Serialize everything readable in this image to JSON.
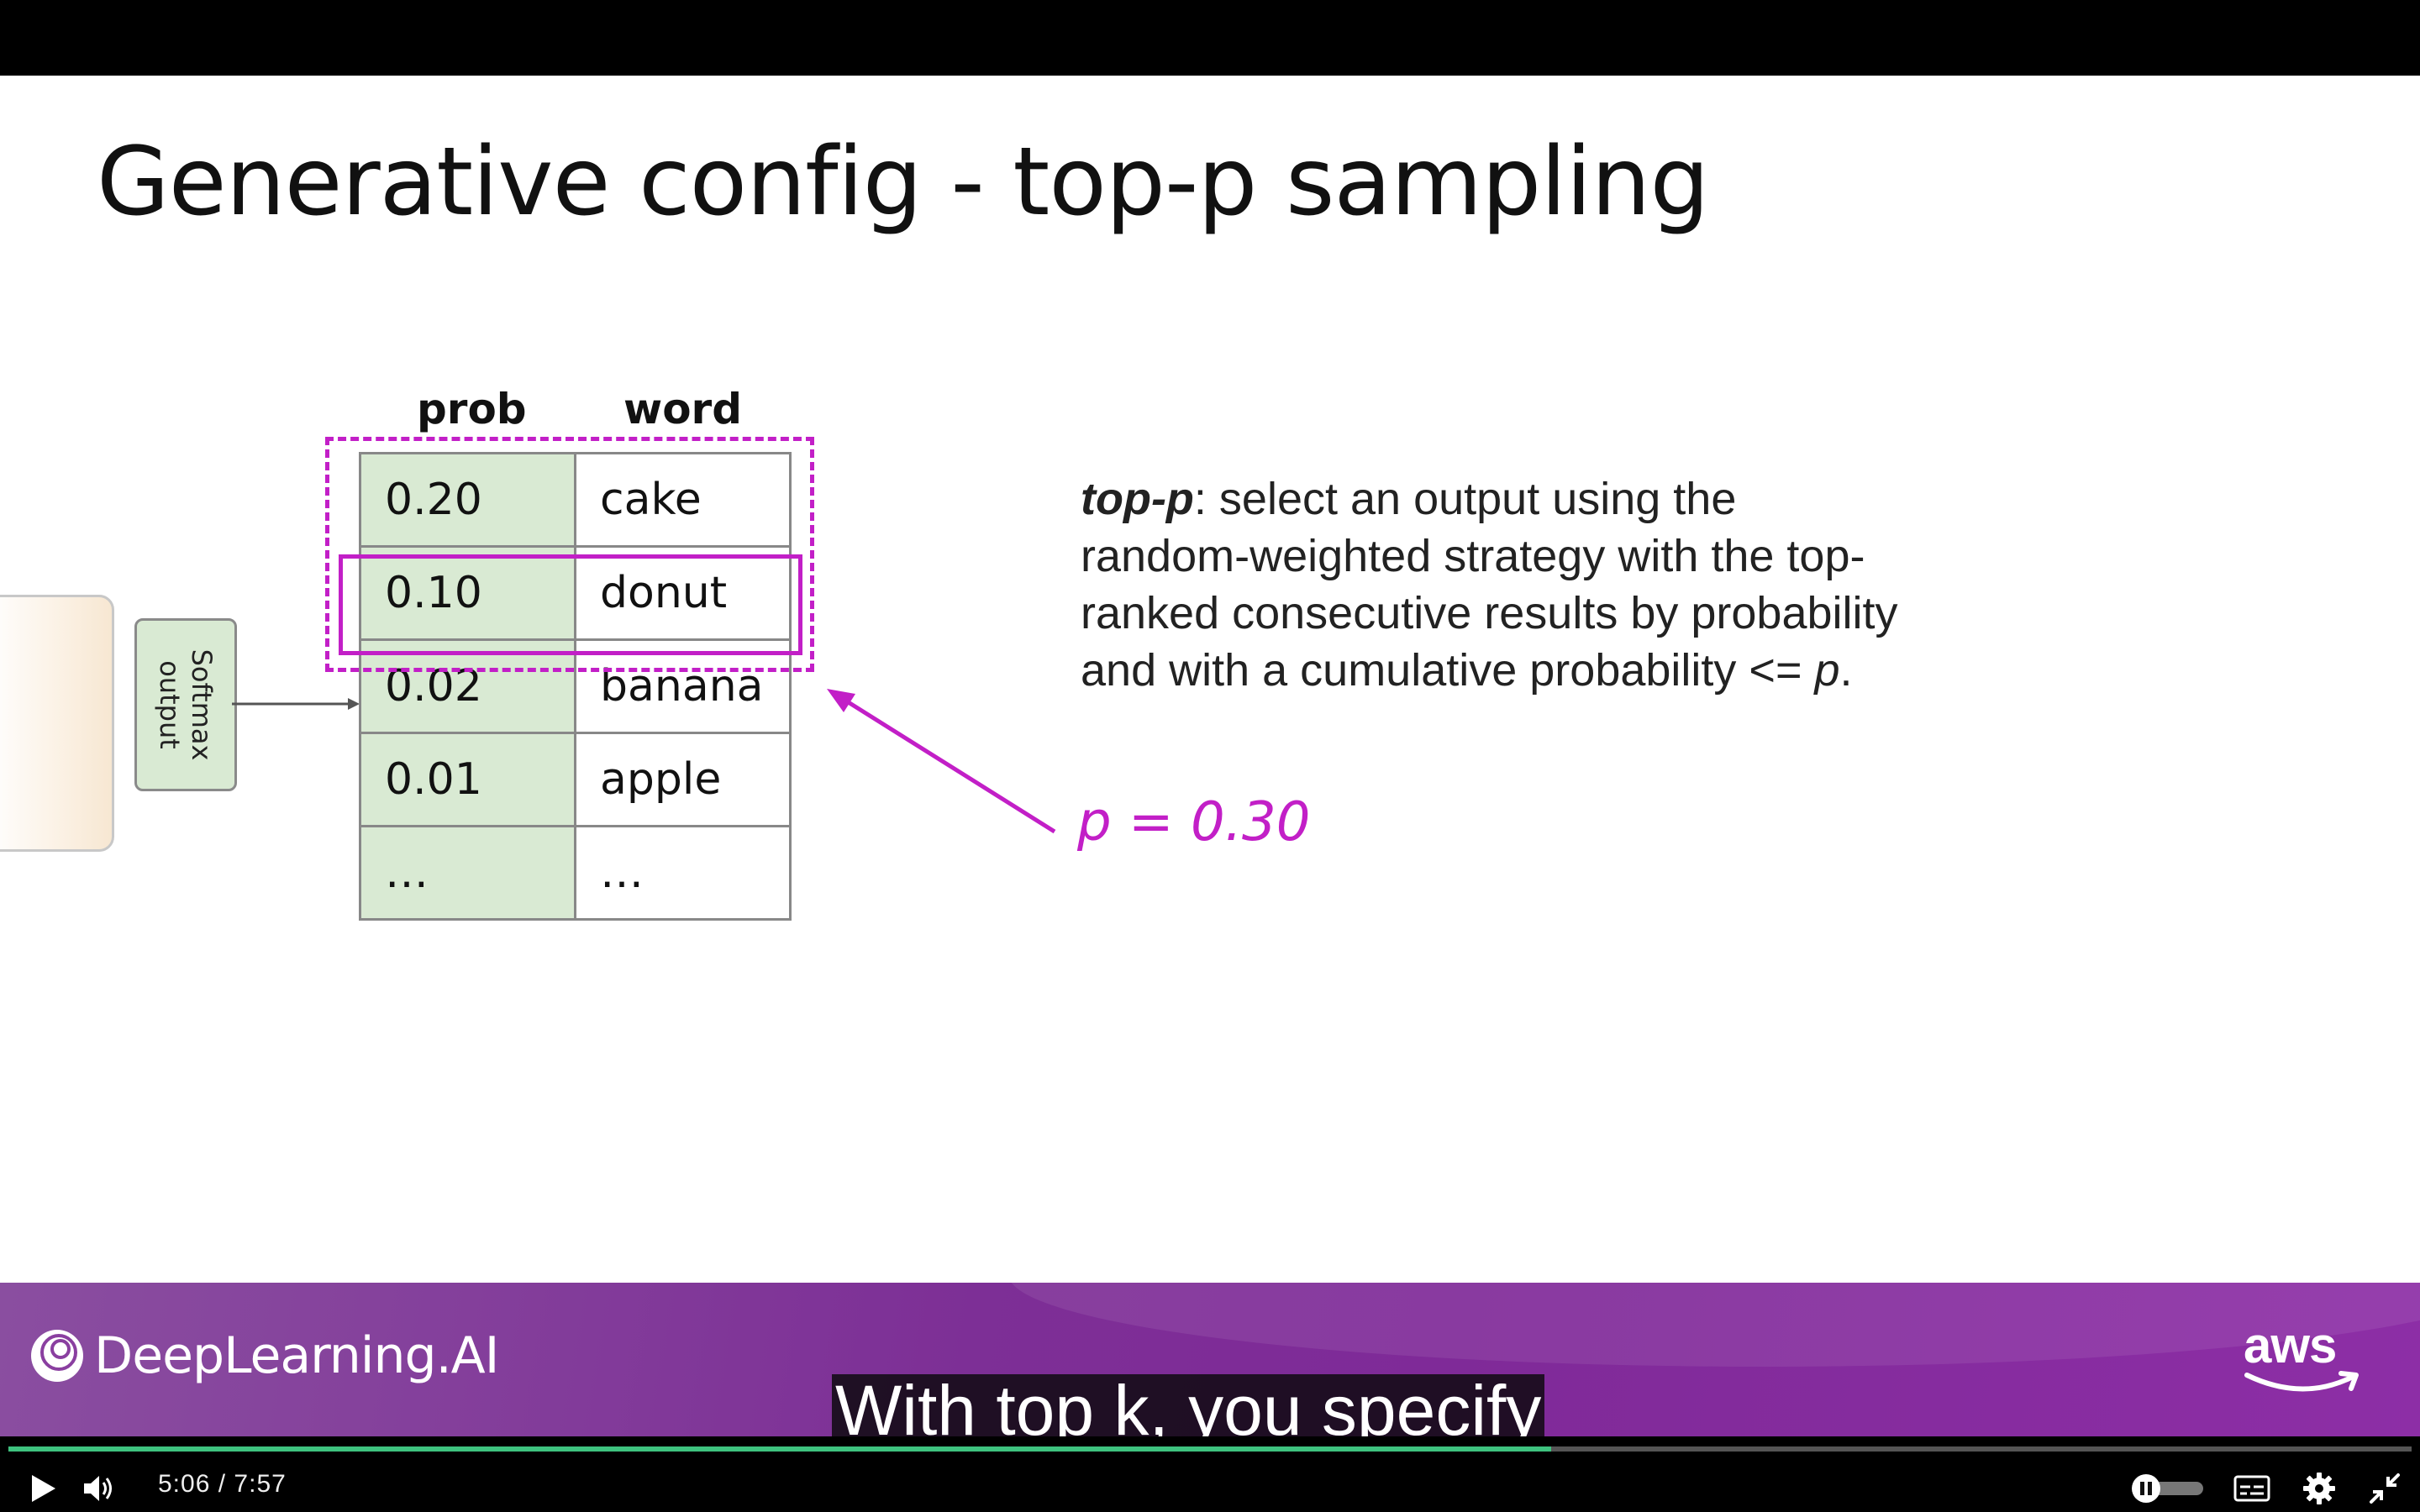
{
  "slide": {
    "title": "Generative config - top-p sampling",
    "softmax_label": "Softmax\noutput",
    "columns": {
      "prob": "prob",
      "word": "word"
    },
    "rows": [
      {
        "prob": "0.20",
        "word": "cake"
      },
      {
        "prob": "0.10",
        "word": "donut"
      },
      {
        "prob": "0.02",
        "word": "banana"
      },
      {
        "prob": "0.01",
        "word": "apple"
      },
      {
        "prob": "…",
        "word": "…"
      }
    ],
    "description": {
      "term": "top-p",
      "text": ": select an output using the random-weighted strategy with the top-ranked consecutive results by probability and with a cumulative probability <= ",
      "var": "p",
      "end": "."
    },
    "p_value": "p = 0.30",
    "highlight_color": "#c21fc7"
  },
  "footer": {
    "brand": "DeepLearning.AI",
    "partner": "aws"
  },
  "caption": "With top k, you specify",
  "player": {
    "current_time": "5:06",
    "separator": "/",
    "duration": "7:57",
    "progress": 0.642,
    "progress_color": "#3ec27f",
    "icons": [
      "play-icon",
      "volume-icon",
      "pause-toggle-icon",
      "captions-icon",
      "settings-icon",
      "exit-fullscreen-icon"
    ]
  }
}
